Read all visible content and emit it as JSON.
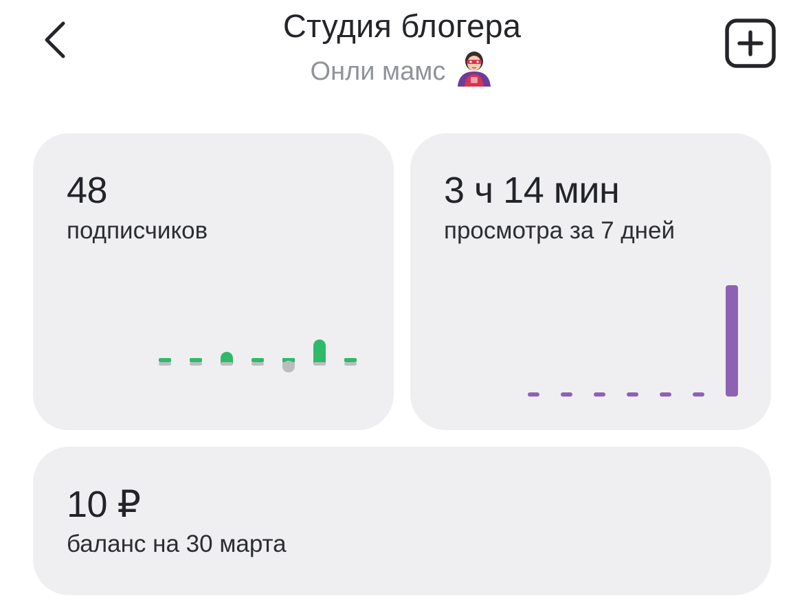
{
  "header": {
    "title": "Студия блогера",
    "subtitle": "Онли мамс",
    "back_icon": "chevron-left-icon",
    "add_icon": "plus-square-icon",
    "avatar_icon": "superhero-woman-emoji"
  },
  "subscribers": {
    "value": "48",
    "label": "подписчиков",
    "chart_data": {
      "type": "bar",
      "values": [
        0,
        0,
        1,
        0,
        -1,
        3,
        0
      ],
      "colors": {
        "positive": "#2fba6a",
        "negative": "#bcbcc0",
        "baseline": "#bcbcc0"
      }
    }
  },
  "views": {
    "value": "3 ч 14 мин",
    "label": "просмотра за 7 дней",
    "chart_data": {
      "type": "bar",
      "values": [
        0,
        0,
        0,
        0,
        0,
        0,
        194
      ],
      "colors": {
        "bar": "#8d62b3"
      }
    }
  },
  "balance": {
    "value": "10 ₽",
    "label": "баланс на 30 марта"
  }
}
